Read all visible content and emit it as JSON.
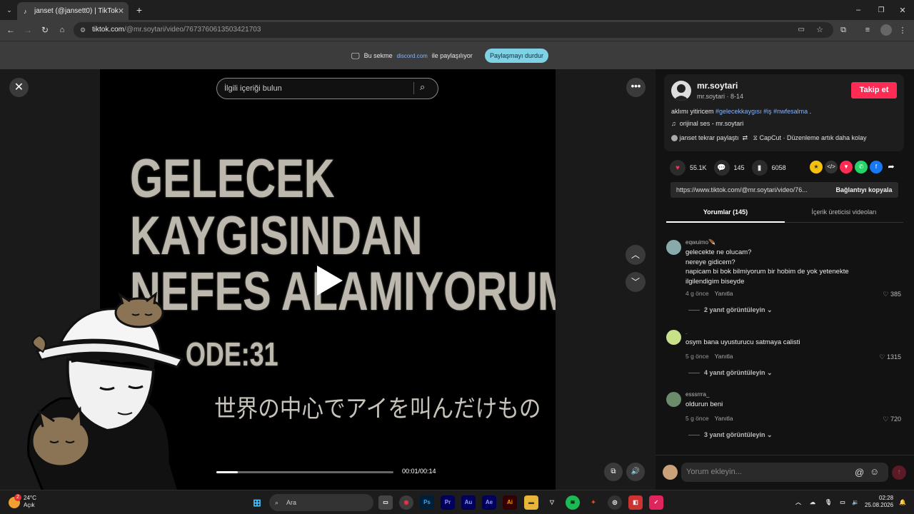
{
  "browser": {
    "tab_title": "janset (@jansett0) | TikTok",
    "url_host": "tiktok.com",
    "url_path": "/@mr.soytari/video/7673760613503421703"
  },
  "share_bar": {
    "prefix": "Bu sekme",
    "site": "discord.com",
    "suffix": "ile paylaşılıyor",
    "stop_label": "Paylaşmayı durdur"
  },
  "video": {
    "search_placeholder": "İlgili içeriği bulun",
    "overlay_lines": [
      "GELECEK",
      "KAYGISINDAN",
      "NEFES ALAMIYORUM",
      "ODE:31"
    ],
    "japanese_caption": "世界の中心でアイを叫んだけもの",
    "time": "00:01/00:14",
    "progress_fraction": 0.12
  },
  "post": {
    "username": "mr.soytari",
    "subline": "mr.soytari · 8-14",
    "follow_label": "Takip et",
    "desc_text": "aklımı yitiricem",
    "hashtags": [
      "#gelecekkaygısı",
      "#iş",
      "#nwfesalma"
    ],
    "desc_end": ".",
    "music": "orijinal ses - mr.soytari",
    "repost": "janset tekrar paylaştı",
    "promo": "CapCut · Düzenleme artık daha kolay",
    "likes": "55.1K",
    "comments": "145",
    "saves": "6058",
    "link": "https://www.tiktok.com/@mr.soytari/video/76...",
    "copy_label": "Bağlantıyı kopyala",
    "tab_comments": "Yorumlar (145)",
    "tab_creator": "İçerik üreticisi videoları"
  },
  "comments": [
    {
      "user": "eqwuimo🪶",
      "text": "gelecekte ne olucam?\nnereye gidicem?\nnapicam bi bok bilmiyorum bir hobim de yok yetenekte\nilgilendigim biseyde",
      "age": "4 g önce",
      "reply": "Yanıtla",
      "likes": "385",
      "replies": "2 yanıt görüntüleyin"
    },
    {
      "user": ".",
      "text": "osym bana uyusturucu satmaya calisti",
      "age": "5 g önce",
      "reply": "Yanıtla",
      "likes": "1315",
      "replies": "4 yanıt görüntüleyin"
    },
    {
      "user": "esssrrra_",
      "text": "oldurun beni",
      "age": "5 g önce",
      "reply": "Yanıtla",
      "likes": "720",
      "replies": "3 yanıt görüntüleyin"
    }
  ],
  "composer": {
    "placeholder": "Yorum ekleyin..."
  },
  "taskbar": {
    "temp": "24°C",
    "condition": "Açık",
    "search": "Ara",
    "time": "02:28",
    "date": "25.08.2026",
    "badge": "2"
  },
  "colors": {
    "accent": "#fe2c55",
    "link": "#8ab4f8",
    "stop": "#7fd1e6"
  }
}
